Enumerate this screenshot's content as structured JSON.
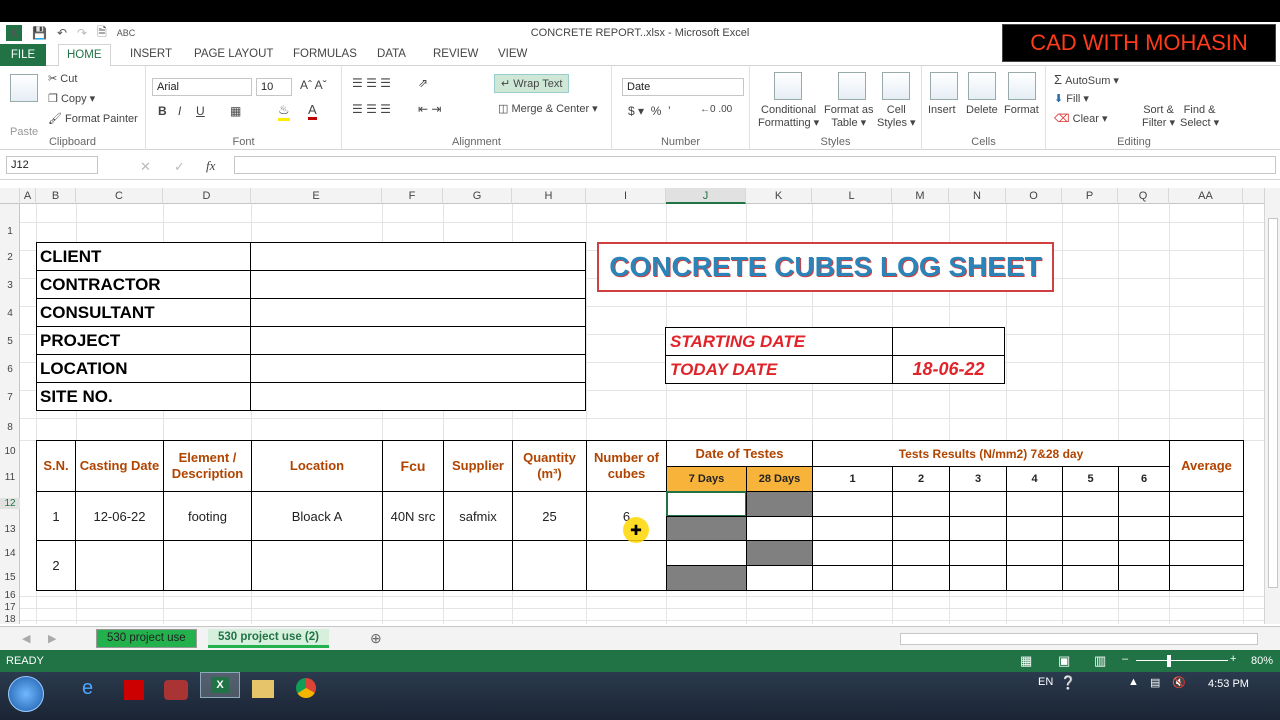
{
  "window": {
    "title": "CONCRETE REPORT..xlsx - Microsoft Excel"
  },
  "ribbon_tabs": [
    "FILE",
    "HOME",
    "INSERT",
    "PAGE LAYOUT",
    "FORMULAS",
    "DATA",
    "REVIEW",
    "VIEW"
  ],
  "clipboard": {
    "paste": "Paste",
    "cut": "Cut",
    "copy": "Copy",
    "format_painter": "Format Painter",
    "label": "Clipboard"
  },
  "font": {
    "name": "Arial",
    "size": "10",
    "label": "Font"
  },
  "alignment": {
    "wrap": "Wrap Text",
    "merge": "Merge & Center",
    "label": "Alignment"
  },
  "number": {
    "format": "Date",
    "label": "Number"
  },
  "styles": {
    "conditional": "Conditional",
    "formatting": "Formatting",
    "format_as": "Format as",
    "table": "Table",
    "cell": "Cell",
    "styles_l": "Styles",
    "label": "Styles"
  },
  "cells": {
    "insert": "Insert",
    "delete": "Delete",
    "format": "Format",
    "label": "Cells"
  },
  "editing": {
    "autosum": "AutoSum",
    "fill": "Fill",
    "clear": "Clear",
    "sort": "Sort &",
    "filter": "Filter",
    "find": "Find &",
    "select": "Select",
    "label": "Editing"
  },
  "formula_bar": {
    "name_box": "J12",
    "fx": "fx",
    "value": ""
  },
  "columns": [
    "A",
    "B",
    "C",
    "D",
    "E",
    "F",
    "G",
    "H",
    "I",
    "J",
    "K",
    "L",
    "M",
    "N",
    "O",
    "P",
    "Q",
    "AA"
  ],
  "rows": [
    "1",
    "2",
    "3",
    "4",
    "5",
    "6",
    "7",
    "8",
    "10",
    "11",
    "12",
    "13",
    "14",
    "15",
    "16",
    "17",
    "18"
  ],
  "info": {
    "client": "CLIENT",
    "contractor": "CONTRACTOR",
    "consultant": "CONSULTANT",
    "project": "PROJECT",
    "location": "LOCATION",
    "site": "SITE NO."
  },
  "sheet_title": "CONCRETE CUBES LOG SHEET",
  "dates": {
    "start_label": "STARTING DATE",
    "start_value": "",
    "today_label": "TODAY DATE",
    "today_value": "18-06-22"
  },
  "table": {
    "headers": {
      "sn": "S.N.",
      "casting": "Casting Date",
      "element": "Element / Description",
      "location": "Location",
      "fcu": "Fcu",
      "supplier": "Supplier",
      "quantity": "Quantity (m³)",
      "cubes": "Number of cubes",
      "date_tests": "Date of Testes",
      "d7": "7 Days",
      "d28": "28 Days",
      "results": "Tests Results (N/mm2) 7&28 day",
      "r1": "1",
      "r2": "2",
      "r3": "3",
      "r4": "4",
      "r5": "5",
      "r6": "6",
      "average": "Average"
    },
    "rows": [
      {
        "sn": "1",
        "casting": "12-06-22",
        "element": "footing",
        "location": "Bloack A",
        "fcu": "40N src",
        "supplier": "safmix",
        "quantity": "25",
        "cubes": "6"
      },
      {
        "sn": "2",
        "casting": "",
        "element": "",
        "location": "",
        "fcu": "",
        "supplier": "",
        "quantity": "",
        "cubes": ""
      }
    ]
  },
  "sheet_tabs": [
    "530 project use",
    "530 project use  (2)"
  ],
  "status": {
    "ready": "READY",
    "zoom": "80%"
  },
  "taskbar": {
    "lang": "EN",
    "time": "4:53 PM"
  },
  "watermark": "CAD WITH MOHASIN"
}
